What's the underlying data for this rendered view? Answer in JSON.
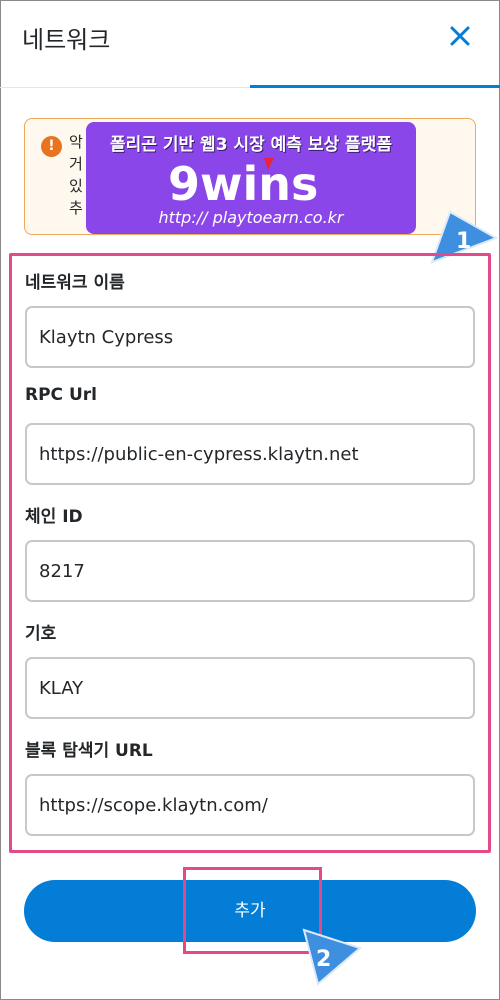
{
  "header": {
    "title": "네트워크"
  },
  "warning": {
    "lines": [
      "악",
      "거",
      "있",
      "추"
    ]
  },
  "promo": {
    "title": "폴리곤 기반 웹3 시장 예측 보상 플랫폼",
    "logo_text": "9wins",
    "url": "http:// playtoearn.co.kr"
  },
  "form": {
    "fields": [
      {
        "label": "네트워크 이름",
        "value": "Klaytn Cypress"
      },
      {
        "label": "RPC Url",
        "value": "https://public-en-cypress.klaytn.net"
      },
      {
        "label": "체인 ID",
        "value": "8217"
      },
      {
        "label": "기호",
        "value": "KLAY"
      },
      {
        "label": "블록 탐색기 URL",
        "value": "https://scope.klaytn.com/"
      }
    ]
  },
  "add_button": {
    "label": "추가"
  },
  "badges": {
    "one": "1",
    "two": "2"
  },
  "colors": {
    "accent": "#037dd6",
    "highlight": "#e24a8a",
    "warning_border": "#f0a85a",
    "promo_bg": "#8a46e8"
  }
}
